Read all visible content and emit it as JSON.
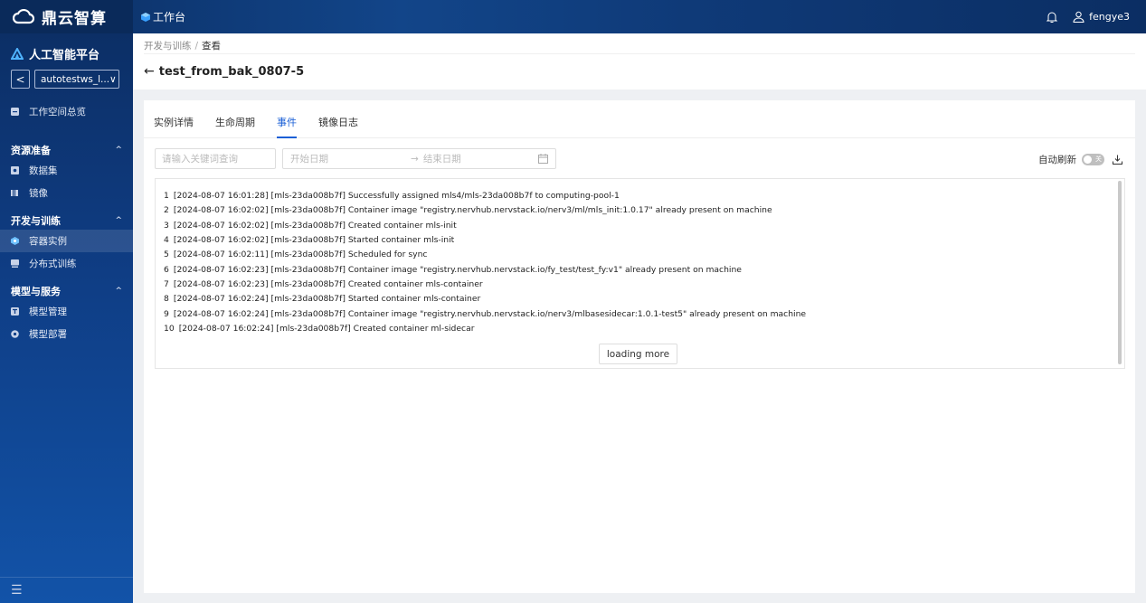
{
  "topbar": {
    "brand": "鼎云智算",
    "workbench_label": "工作台",
    "username": "fengye3"
  },
  "sidebar": {
    "platform_title": "人工智能平台",
    "workspace_back": "<",
    "workspace_value": "autotestws_l...",
    "overview": "工作空间总览",
    "sections": [
      {
        "title": "资源准备",
        "items": [
          {
            "label": "数据集",
            "icon": "dataset-icon"
          },
          {
            "label": "镜像",
            "icon": "image-icon"
          }
        ]
      },
      {
        "title": "开发与训练",
        "items": [
          {
            "label": "容器实例",
            "icon": "container-icon",
            "active": true
          },
          {
            "label": "分布式训练",
            "icon": "distributed-icon"
          }
        ]
      },
      {
        "title": "模型与服务",
        "items": [
          {
            "label": "模型管理",
            "icon": "model-icon"
          },
          {
            "label": "模型部署",
            "icon": "deploy-icon"
          }
        ]
      }
    ],
    "menu_toggle": "☰"
  },
  "header": {
    "breadcrumb": [
      "开发与训练",
      "查看"
    ],
    "breadcrumb_sep": "/",
    "title": "test_from_bak_0807-5"
  },
  "tabs": [
    "实例详情",
    "生命周期",
    "事件",
    "镜像日志"
  ],
  "active_tab": 2,
  "filters": {
    "search_placeholder": "请输入关键词查询",
    "start_date_placeholder": "开始日期",
    "end_date_placeholder": "结束日期",
    "date_arrow": "→",
    "auto_refresh_label": "自动刷新",
    "auto_refresh_state": "关"
  },
  "events": [
    {
      "n": "1",
      "text": "[2024-08-07 16:01:28] [mls-23da008b7f] Successfully assigned mls4/mls-23da008b7f to computing-pool-1"
    },
    {
      "n": "2",
      "text": "[2024-08-07 16:02:02] [mls-23da008b7f] Container image \"registry.nervhub.nervstack.io/nerv3/ml/mls_init:1.0.17\" already present on machine"
    },
    {
      "n": "3",
      "text": "[2024-08-07 16:02:02] [mls-23da008b7f] Created container mls-init"
    },
    {
      "n": "4",
      "text": "[2024-08-07 16:02:02] [mls-23da008b7f] Started container mls-init"
    },
    {
      "n": "5",
      "text": "[2024-08-07 16:02:11] [mls-23da008b7f] Scheduled for sync"
    },
    {
      "n": "6",
      "text": "[2024-08-07 16:02:23] [mls-23da008b7f] Container image \"registry.nervhub.nervstack.io/fy_test/test_fy:v1\" already present on machine"
    },
    {
      "n": "7",
      "text": "[2024-08-07 16:02:23] [mls-23da008b7f] Created container mls-container"
    },
    {
      "n": "8",
      "text": "[2024-08-07 16:02:24] [mls-23da008b7f] Started container mls-container"
    },
    {
      "n": "9",
      "text": "[2024-08-07 16:02:24] [mls-23da008b7f] Container image \"registry.nervhub.nervstack.io/nerv3/mlbasesidecar:1.0.1-test5\" already present on machine"
    },
    {
      "n": "10",
      "text": "[2024-08-07 16:02:24] [mls-23da008b7f] Created container ml-sidecar"
    }
  ],
  "loading_more": "loading more",
  "colors": {
    "accent": "#1a5fd6",
    "topbar": "#0f3a78",
    "sidebar": "#0f3e86"
  }
}
